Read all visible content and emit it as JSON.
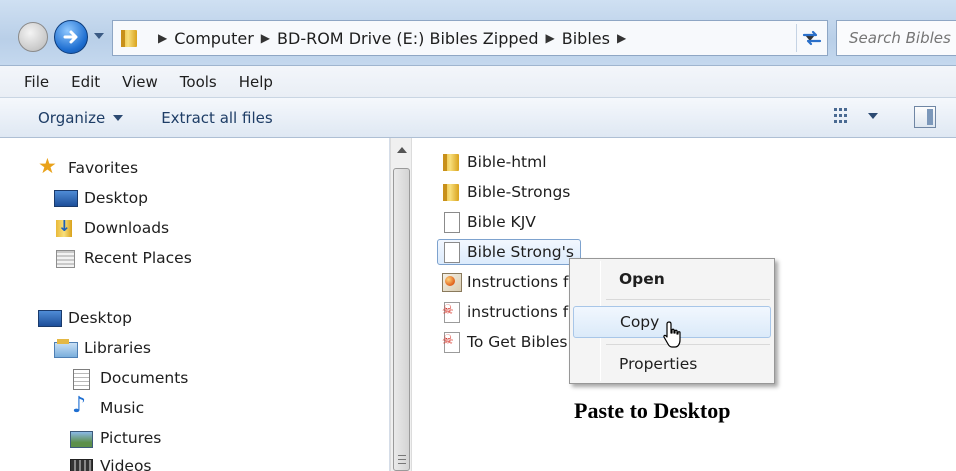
{
  "address_bar": {
    "crumbs": [
      "Computer",
      "BD-ROM Drive (E:) Bibles Zipped",
      "Bibles"
    ],
    "search_placeholder": "Search Bibles"
  },
  "menu_bar": {
    "items": [
      "File",
      "Edit",
      "View",
      "Tools",
      "Help"
    ]
  },
  "command_bar": {
    "organize_label": "Organize",
    "extract_label": "Extract all files"
  },
  "nav_pane": {
    "favorites_label": "Favorites",
    "favorites": [
      "Desktop",
      "Downloads",
      "Recent Places"
    ],
    "desktop_label": "Desktop",
    "libraries_label": "Libraries",
    "libraries": [
      "Documents",
      "Music",
      "Pictures",
      "Videos"
    ]
  },
  "files": [
    {
      "name": "Bible-html",
      "icon": "folder-icon"
    },
    {
      "name": "Bible-Strongs",
      "icon": "folder-icon"
    },
    {
      "name": "Bible KJV",
      "icon": "document-icon"
    },
    {
      "name": "Bible Strong's",
      "icon": "document-icon"
    },
    {
      "name": "Instructions f",
      "icon": "html-document-icon"
    },
    {
      "name": "instructions f",
      "icon": "pdf-icon"
    },
    {
      "name": "To Get Bibles",
      "icon": "pdf-icon"
    }
  ],
  "context_menu": {
    "open_label": "Open",
    "copy_label": "Copy",
    "properties_label": "Properties"
  },
  "caption": "Paste to Desktop",
  "colors": {
    "selection_border": "#7da2ce",
    "accent_blue": "#1f6fd1"
  }
}
